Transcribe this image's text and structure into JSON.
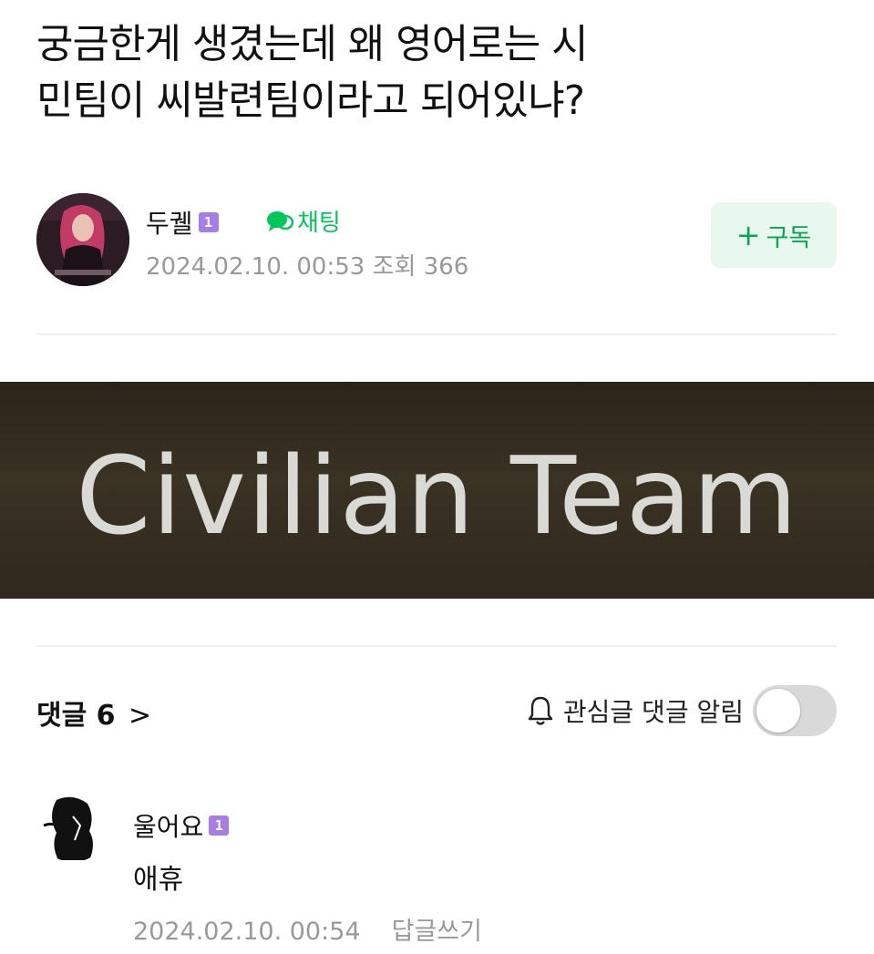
{
  "post": {
    "title_line1": "궁금한게 생겼는데 왜 영어로는 시",
    "title_line2": "민팀이 씨발련팀이라고 되어있냐?",
    "author": "두궬",
    "author_level": "1",
    "chat_label": "채팅",
    "date": "2024.02.10. 00:53",
    "views_label": "조회 366",
    "subscribe_label": "구독",
    "subscribe_plus": "+"
  },
  "banner": {
    "text": "Civilian Team"
  },
  "comments_header": {
    "label": "댓글",
    "count": "6",
    "chevron": ">",
    "notify_label": "관심글 댓글 알림",
    "notify_on": false
  },
  "comments": [
    {
      "author": "울어요",
      "level": "1",
      "text": "애휴",
      "date": "2024.02.10. 00:54",
      "reply_label": "답글쓰기"
    }
  ],
  "colors": {
    "accent_green": "#03c75a",
    "subscribe_bg": "#e8f8ee",
    "level_badge": "#a77ee8",
    "meta_gray": "#999999"
  },
  "icons": [
    "chat-bubble-icon",
    "bell-icon",
    "plus-icon",
    "chevron-right-icon"
  ]
}
